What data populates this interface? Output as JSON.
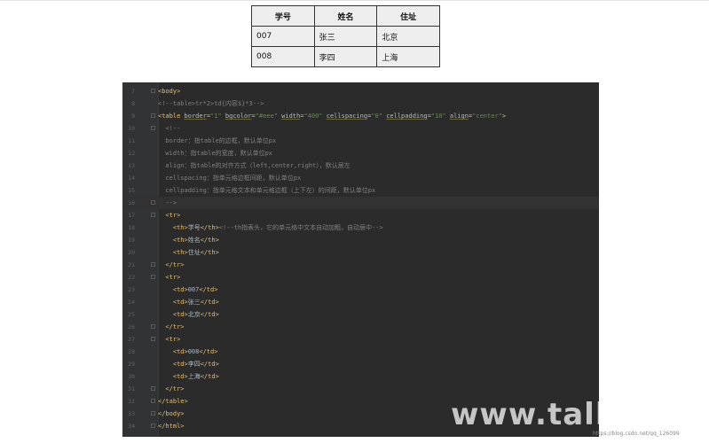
{
  "table": {
    "headers": [
      "学号",
      "姓名",
      "住址"
    ],
    "rows": [
      [
        "007",
        "张三",
        "北京"
      ],
      [
        "008",
        "李四",
        "上海"
      ]
    ]
  },
  "editor": {
    "current_line": 16,
    "lines": [
      {
        "n": "7",
        "fold": true,
        "segs": [
          [
            "tag",
            "<body>"
          ]
        ]
      },
      {
        "n": "8",
        "fold": false,
        "segs": [
          [
            "cm",
            "<!--table>tr*2>td{内容$}*3-->"
          ]
        ]
      },
      {
        "n": "9",
        "fold": true,
        "segs": [
          [
            "tag",
            "<table "
          ],
          [
            "attr",
            "border"
          ],
          [
            "tag",
            "="
          ],
          [
            "val",
            "\"1\""
          ],
          [
            "tag",
            " "
          ],
          [
            "attr",
            "bgcolor"
          ],
          [
            "tag",
            "="
          ],
          [
            "val",
            "\"#eee\""
          ],
          [
            "tag",
            " "
          ],
          [
            "attr",
            "width"
          ],
          [
            "tag",
            "="
          ],
          [
            "val",
            "\"400\""
          ],
          [
            "tag",
            " "
          ],
          [
            "attr",
            "cellspacing"
          ],
          [
            "tag",
            "="
          ],
          [
            "val",
            "\"0\""
          ],
          [
            "tag",
            " "
          ],
          [
            "attr",
            "cellpadding"
          ],
          [
            "tag",
            "="
          ],
          [
            "val",
            "\"10\""
          ],
          [
            "tag",
            " "
          ],
          [
            "attr",
            "align"
          ],
          [
            "tag",
            "="
          ],
          [
            "val",
            "\"center\""
          ],
          [
            "tag",
            ">"
          ]
        ]
      },
      {
        "n": "10",
        "fold": true,
        "segs": [
          [
            "cm",
            "  <!--"
          ]
        ]
      },
      {
        "n": "11",
        "fold": false,
        "segs": [
          [
            "cm",
            "  border：指table的边框，默认单位px"
          ]
        ]
      },
      {
        "n": "12",
        "fold": false,
        "segs": [
          [
            "cm",
            "  width：指table的宽度，默认单位px"
          ]
        ]
      },
      {
        "n": "13",
        "fold": false,
        "segs": [
          [
            "cm",
            "  align：指table的对齐方式（left,center,right），默认居左"
          ]
        ]
      },
      {
        "n": "14",
        "fold": false,
        "segs": [
          [
            "cm",
            "  cellspacing：指单元格边框间距，默认单位px"
          ]
        ]
      },
      {
        "n": "15",
        "fold": false,
        "segs": [
          [
            "cm",
            "  cellpadding：指单元格文本和单元格边框（上下左）的间距，默认单位px"
          ]
        ]
      },
      {
        "n": "16",
        "fold": true,
        "segs": [
          [
            "cm",
            "  -->"
          ]
        ]
      },
      {
        "n": "17",
        "fold": true,
        "segs": [
          [
            "tag",
            "  <tr>"
          ]
        ]
      },
      {
        "n": "18",
        "fold": false,
        "segs": [
          [
            "tag",
            "    <th>"
          ],
          [
            "tx",
            "学号"
          ],
          [
            "tag",
            "</th>"
          ],
          [
            "cm",
            "<!--th指表头，它的单元格中文本自动加粗，自动居中-->"
          ]
        ]
      },
      {
        "n": "19",
        "fold": false,
        "segs": [
          [
            "tag",
            "    <th>"
          ],
          [
            "tx",
            "姓名"
          ],
          [
            "tag",
            "</th>"
          ]
        ]
      },
      {
        "n": "20",
        "fold": false,
        "segs": [
          [
            "tag",
            "    <th>"
          ],
          [
            "tx",
            "住址"
          ],
          [
            "tag",
            "</th>"
          ]
        ]
      },
      {
        "n": "21",
        "fold": true,
        "segs": [
          [
            "tag",
            "  </tr>"
          ]
        ]
      },
      {
        "n": "22",
        "fold": true,
        "segs": [
          [
            "tag",
            "  <tr>"
          ]
        ]
      },
      {
        "n": "23",
        "fold": false,
        "segs": [
          [
            "tag",
            "    <td>"
          ],
          [
            "tx",
            "007"
          ],
          [
            "tag",
            "</td>"
          ]
        ]
      },
      {
        "n": "24",
        "fold": false,
        "segs": [
          [
            "tag",
            "    <td>"
          ],
          [
            "tx",
            "张三"
          ],
          [
            "tag",
            "</td>"
          ]
        ]
      },
      {
        "n": "25",
        "fold": false,
        "segs": [
          [
            "tag",
            "    <td>"
          ],
          [
            "tx",
            "北京"
          ],
          [
            "tag",
            "</td>"
          ]
        ]
      },
      {
        "n": "26",
        "fold": true,
        "segs": [
          [
            "tag",
            "  </tr>"
          ]
        ]
      },
      {
        "n": "27",
        "fold": true,
        "segs": [
          [
            "tag",
            "  <tr>"
          ]
        ]
      },
      {
        "n": "28",
        "fold": false,
        "segs": [
          [
            "tag",
            "    <td>"
          ],
          [
            "tx",
            "008"
          ],
          [
            "tag",
            "</td>"
          ]
        ]
      },
      {
        "n": "29",
        "fold": false,
        "segs": [
          [
            "tag",
            "    <td>"
          ],
          [
            "tx",
            "李四"
          ],
          [
            "tag",
            "</td>"
          ]
        ]
      },
      {
        "n": "30",
        "fold": false,
        "segs": [
          [
            "tag",
            "    <td>"
          ],
          [
            "tx",
            "上海"
          ],
          [
            "tag",
            "</td>"
          ]
        ]
      },
      {
        "n": "31",
        "fold": true,
        "segs": [
          [
            "tag",
            "  </tr>"
          ]
        ]
      },
      {
        "n": "32",
        "fold": true,
        "segs": [
          [
            "tag",
            "</table>"
          ]
        ]
      },
      {
        "n": "33",
        "fold": true,
        "segs": [
          [
            "tag",
            "</body>"
          ]
        ]
      },
      {
        "n": "34",
        "fold": true,
        "segs": [
          [
            "tag",
            "</html>"
          ]
        ]
      }
    ]
  },
  "watermark": "www.talkl",
  "credit": "https://blog.csdn.net/qq_126099"
}
